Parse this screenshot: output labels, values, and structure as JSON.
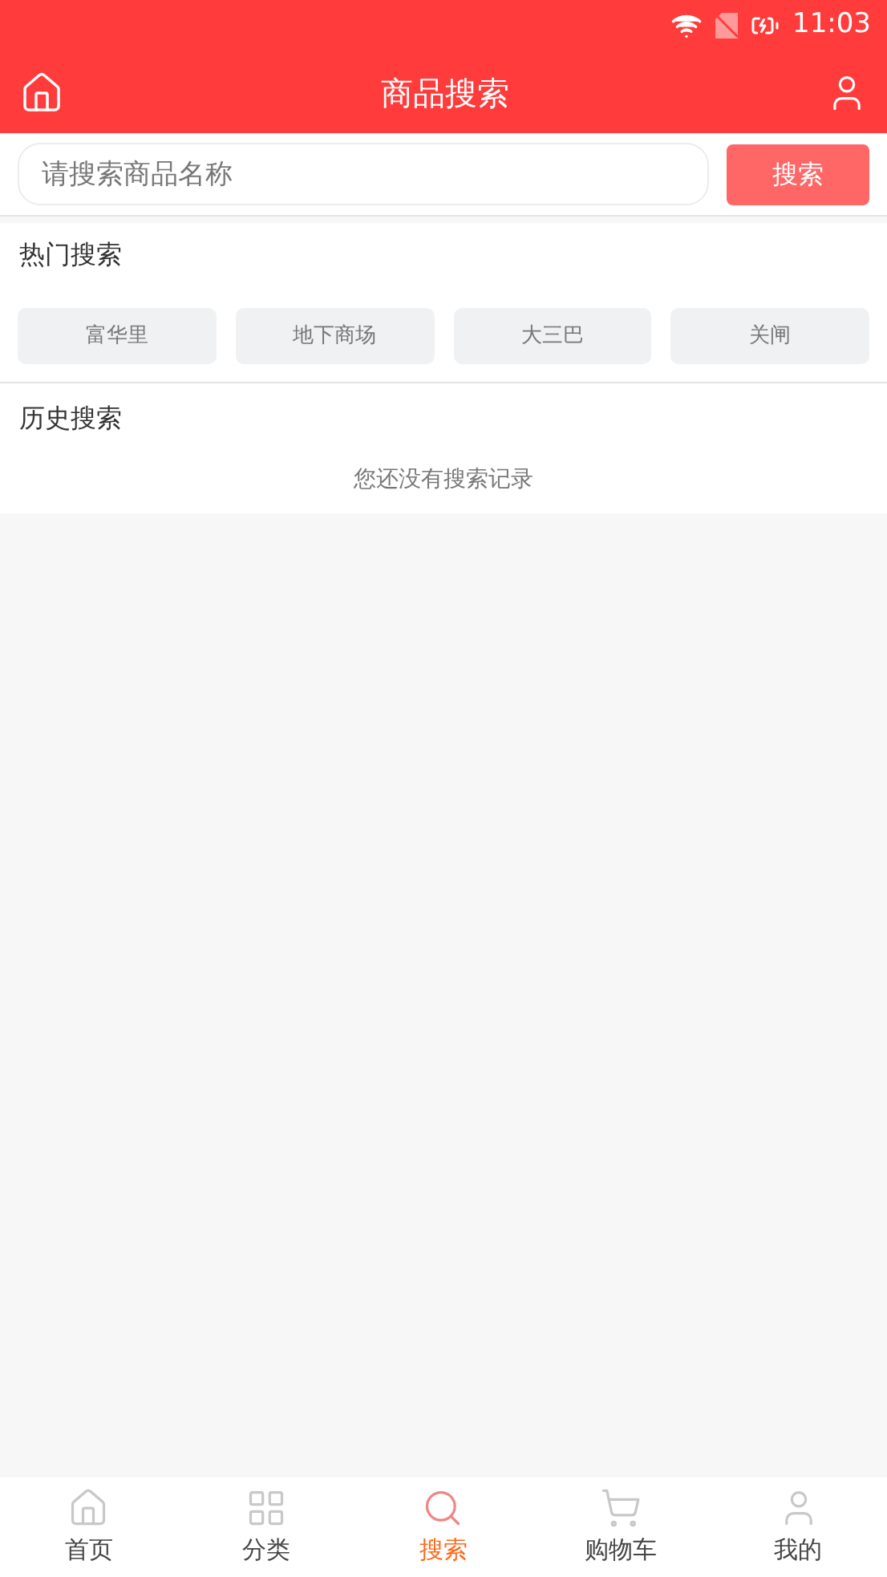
{
  "status_bar": {
    "time": "11:03"
  },
  "header": {
    "title": "商品搜索"
  },
  "search": {
    "placeholder": "请搜索商品名称",
    "button": "搜索"
  },
  "hot_search": {
    "title": "热门搜索",
    "tags": [
      "富华里",
      "地下商场",
      "大三巴",
      "关闸"
    ]
  },
  "history": {
    "title": "历史搜索",
    "empty_text": "您还没有搜索记录"
  },
  "tab_bar": [
    {
      "label": "首页",
      "kind": "home",
      "selected": false
    },
    {
      "label": "分类",
      "kind": "category",
      "selected": false
    },
    {
      "label": "搜索",
      "kind": "search",
      "selected": true
    },
    {
      "label": "购物车",
      "kind": "cart",
      "selected": false
    },
    {
      "label": "我的",
      "kind": "profile",
      "selected": false
    }
  ]
}
